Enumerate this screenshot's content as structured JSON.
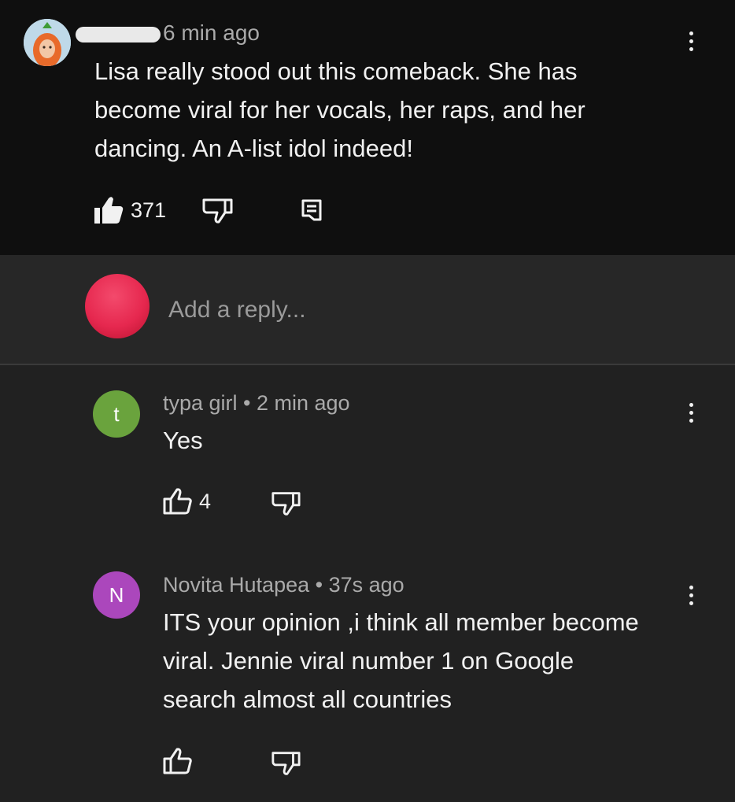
{
  "colors": {
    "top_background": "#0f0f0f",
    "thread_background": "#212121",
    "reply_avatar": "#e6284f",
    "avatar_t": "#6aa33d",
    "avatar_n": "#ab47bc"
  },
  "main_comment": {
    "time": "6 min ago",
    "text": "Lisa really stood out this comeback. She has\nbecome viral for her vocals, her raps, and her\ndancing. An A-list idol indeed!",
    "likes": "371",
    "icons": [
      "like-filled-icon",
      "dislike-icon",
      "reply-comment-icon",
      "more-vert-icon"
    ]
  },
  "reply_box": {
    "placeholder": "Add a reply..."
  },
  "replies": [
    {
      "avatar_letter": "t",
      "meta": "typa girl • 2 min ago",
      "text": "Yes",
      "likes": "4"
    },
    {
      "avatar_letter": "N",
      "meta": "Novita Hutapea • 37s ago",
      "text": "ITS your opinion ,i think all member become\nviral. Jennie viral number 1 on Google\nsearch almost all countries",
      "likes": ""
    }
  ]
}
